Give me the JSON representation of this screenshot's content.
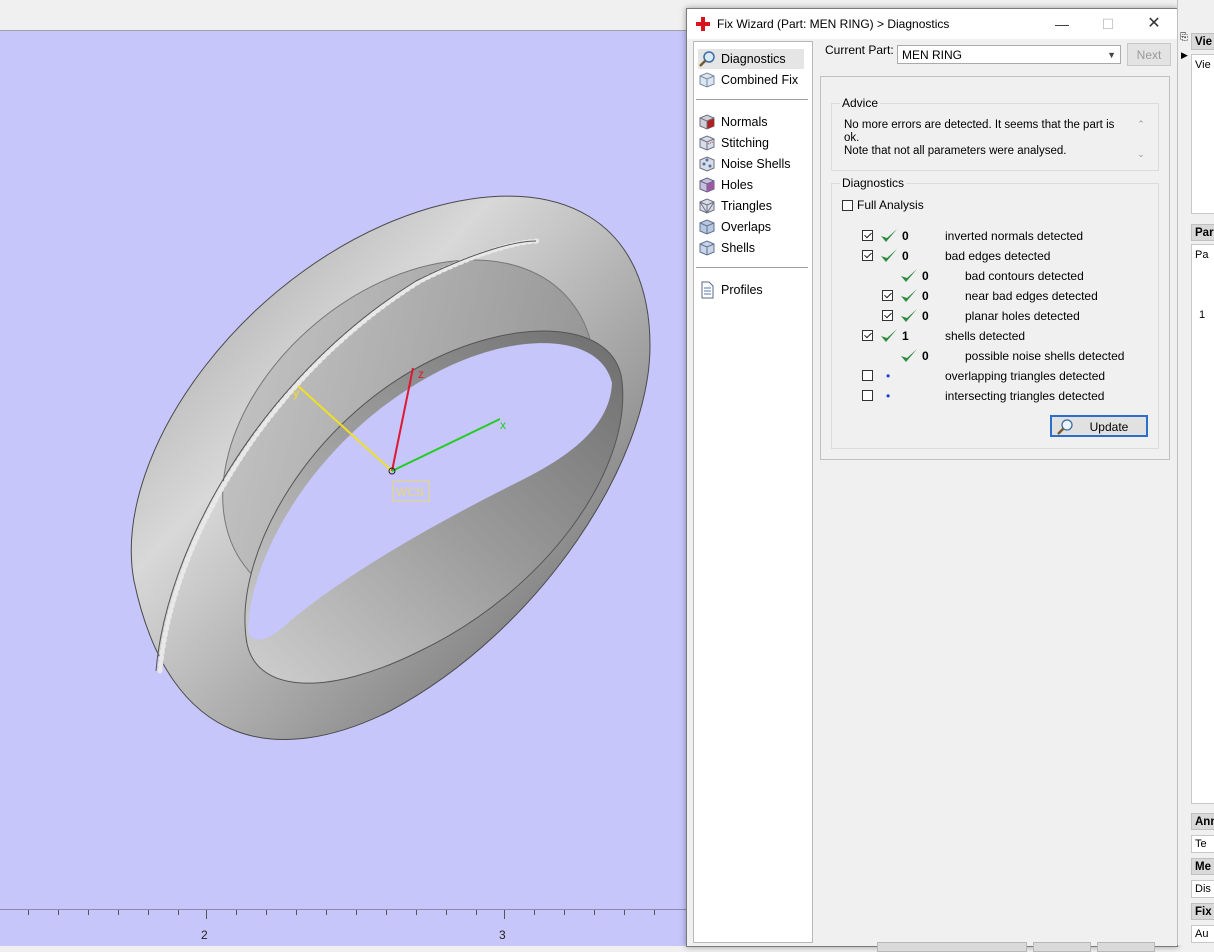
{
  "dialog": {
    "title": "Fix Wizard (Part: MEN RING) > Diagnostics",
    "titlebar_icon": "red-cross-icon",
    "current_part_label": "Current Part:",
    "current_part_value": "MEN RING",
    "next_label": "Next"
  },
  "nav": {
    "top_items": [
      {
        "label": "Diagnostics",
        "icon": "magnifier-icon",
        "selected": true
      },
      {
        "label": "Combined Fix",
        "icon": "cube-icon"
      }
    ],
    "fix_items": [
      {
        "label": "Normals",
        "icon": "normals-cube-icon"
      },
      {
        "label": "Stitching",
        "icon": "stitching-cube-icon"
      },
      {
        "label": "Noise Shells",
        "icon": "noise-shells-icon"
      },
      {
        "label": "Holes",
        "icon": "holes-cube-icon"
      },
      {
        "label": "Triangles",
        "icon": "triangles-cube-icon"
      },
      {
        "label": "Overlaps",
        "icon": "overlaps-cube-icon"
      },
      {
        "label": "Shells",
        "icon": "shells-cube-icon"
      }
    ],
    "bottom_items": [
      {
        "label": "Profiles",
        "icon": "document-icon"
      }
    ]
  },
  "advice": {
    "title": "Advice",
    "line1": "No more errors are detected. It seems that the part is ok.",
    "line2": "Note that not all parameters were analysed."
  },
  "diagnostics": {
    "title": "Diagnostics",
    "full_analysis_label": "Full Analysis",
    "full_analysis_checked": false,
    "rows": [
      {
        "checkbox": true,
        "checked": true,
        "status": "ok",
        "count": "0",
        "label": "inverted normals detected",
        "indent": 0
      },
      {
        "checkbox": true,
        "checked": true,
        "status": "ok",
        "count": "0",
        "label": "bad edges detected",
        "indent": 0
      },
      {
        "checkbox": false,
        "checked": false,
        "status": "ok",
        "count": "0",
        "label": "bad contours detected",
        "indent": 1
      },
      {
        "checkbox": true,
        "checked": true,
        "status": "ok",
        "count": "0",
        "label": "near bad edges detected",
        "indent": 1
      },
      {
        "checkbox": true,
        "checked": true,
        "status": "ok",
        "count": "0",
        "label": "planar holes detected",
        "indent": 1
      },
      {
        "checkbox": true,
        "checked": true,
        "status": "ok",
        "count": "1",
        "label": "shells detected",
        "indent": 0
      },
      {
        "checkbox": false,
        "checked": false,
        "status": "ok",
        "count": "0",
        "label": "possible noise shells detected",
        "indent": 1
      },
      {
        "checkbox": true,
        "checked": false,
        "status": "pending",
        "count": "",
        "label": "overlapping triangles detected",
        "indent": 0
      },
      {
        "checkbox": true,
        "checked": false,
        "status": "pending",
        "count": "",
        "label": "intersecting triangles detected",
        "indent": 0
      }
    ],
    "update_label": "Update"
  },
  "viewport": {
    "background": "#c6c6fb",
    "axes": {
      "x": "x",
      "y": "y",
      "z": "z",
      "origin": "WCS"
    },
    "ruler_labels": [
      "2",
      "3"
    ]
  },
  "right_panel": {
    "headers": [
      "Vie",
      "Par",
      "Ann",
      "Me",
      "Fix"
    ],
    "bodies": [
      "Vie",
      "Pa",
      "1",
      "Te",
      "Dis",
      "Au"
    ]
  },
  "colors": {
    "check_green": "#2e8b3d",
    "update_border": "#2c6fcb",
    "axis_x": "#22cc22",
    "axis_y": "#f0e020",
    "axis_z": "#e01830"
  }
}
